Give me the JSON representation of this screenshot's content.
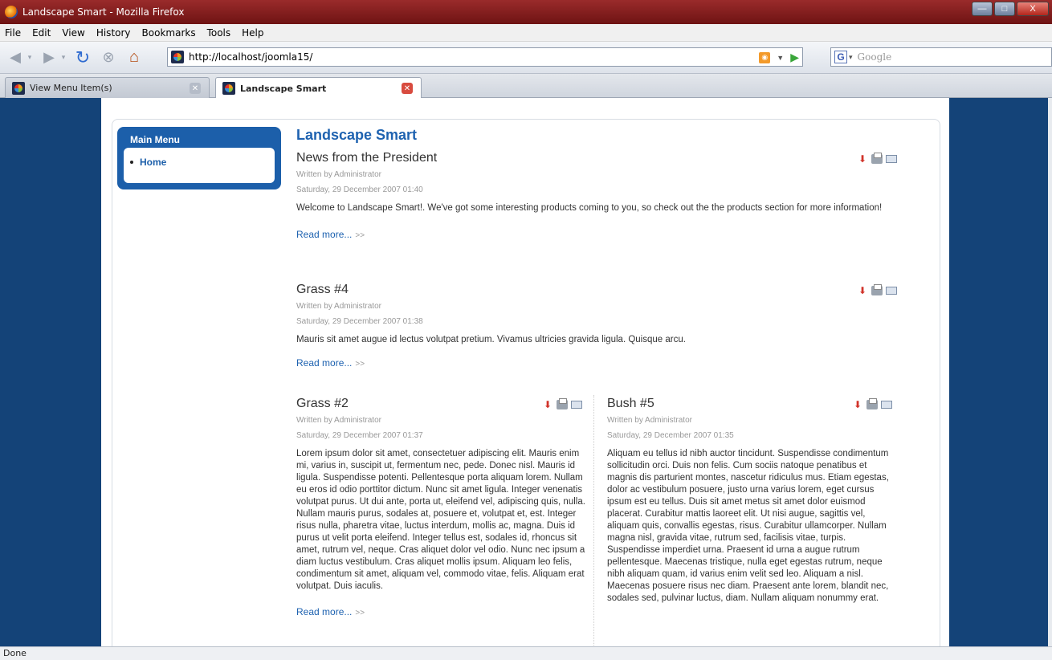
{
  "window": {
    "title": "Landscape Smart - Mozilla Firefox",
    "buttons": {
      "minimize": "—",
      "maximize": "□",
      "close": "X"
    }
  },
  "menubar": {
    "items": [
      "File",
      "Edit",
      "View",
      "History",
      "Bookmarks",
      "Tools",
      "Help"
    ]
  },
  "navbar": {
    "url": "http://localhost/joomla15/",
    "search_placeholder": "Google"
  },
  "tabs": [
    {
      "label": "View Menu Item(s)",
      "active": false
    },
    {
      "label": "Landscape Smart",
      "active": true
    }
  ],
  "page": {
    "main_menu": {
      "title": "Main Menu",
      "items": [
        "Home"
      ]
    },
    "component_heading": "Landscape Smart",
    "articles": [
      {
        "title": "News from the President",
        "author": "Written by Administrator",
        "date": "Saturday, 29 December 2007 01:40",
        "body": "Welcome to Landscape Smart!. We've got some interesting products coming to you, so check out the the products section for more information!",
        "read_more": "Read more...",
        "arrow": ">>"
      },
      {
        "title": "Grass #4",
        "author": "Written by Administrator",
        "date": "Saturday, 29 December 2007 01:38",
        "body": "Mauris sit amet augue id lectus volutpat pretium. Vivamus ultricies gravida ligula. Quisque arcu.",
        "read_more": "Read more...",
        "arrow": ">>"
      },
      {
        "title": "Grass #2",
        "author": "Written by Administrator",
        "date": "Saturday, 29 December 2007 01:37",
        "body": "Lorem ipsum dolor sit amet, consectetuer adipiscing elit. Mauris enim mi, varius in, suscipit ut, fermentum nec, pede. Donec nisl. Mauris id ligula. Suspendisse potenti. Pellentesque porta aliquam lorem. Nullam eu eros id odio porttitor dictum. Nunc sit amet ligula. Integer venenatis volutpat purus. Ut dui ante, porta ut, eleifend vel, adipiscing quis, nulla. Nullam mauris purus, sodales at, posuere et, volutpat et, est. Integer risus nulla, pharetra vitae, luctus interdum, mollis ac, magna. Duis id purus ut velit porta eleifend. Integer tellus est, sodales id, rhoncus sit amet, rutrum vel, neque. Cras aliquet dolor vel odio. Nunc nec ipsum a diam luctus vestibulum. Cras aliquet mollis ipsum. Aliquam leo felis, condimentum sit amet, aliquam vel, commodo vitae, felis. Aliquam erat volutpat. Duis iaculis.",
        "read_more": "Read more...",
        "arrow": ">>"
      },
      {
        "title": "Bush #5",
        "author": "Written by Administrator",
        "date": "Saturday, 29 December 2007 01:35",
        "body": "Aliquam eu tellus id nibh auctor tincidunt. Suspendisse condimentum sollicitudin orci. Duis non felis. Cum sociis natoque penatibus et magnis dis parturient montes, nascetur ridiculus mus. Etiam egestas, dolor ac vestibulum posuere, justo urna varius lorem, eget cursus ipsum est eu tellus. Duis sit amet metus sit amet dolor euismod placerat. Curabitur mattis laoreet elit. Ut nisi augue, sagittis vel, aliquam quis, convallis egestas, risus. Curabitur ullamcorper. Nullam magna nisl, gravida vitae, rutrum sed, facilisis vitae, turpis. Suspendisse imperdiet urna. Praesent id urna a augue rutrum pellentesque. Maecenas tristique, nulla eget egestas rutrum, neque nibh aliquam quam, id varius enim velit sed leo. Aliquam a nisl. Maecenas posuere risus nec diam. Praesent ante lorem, blandit nec, sodales sed, pulvinar luctus, diam. Nullam aliquam nonummy erat."
      }
    ]
  },
  "status": {
    "text": "Done"
  },
  "colors": {
    "page_bg": "#144378",
    "menu_blue": "#1c5faa",
    "link_blue": "#1e62b0",
    "titlebar": "#8b1e1e"
  },
  "icons": {
    "pdf": "pdf-icon",
    "print": "print-icon",
    "email": "email-icon"
  }
}
